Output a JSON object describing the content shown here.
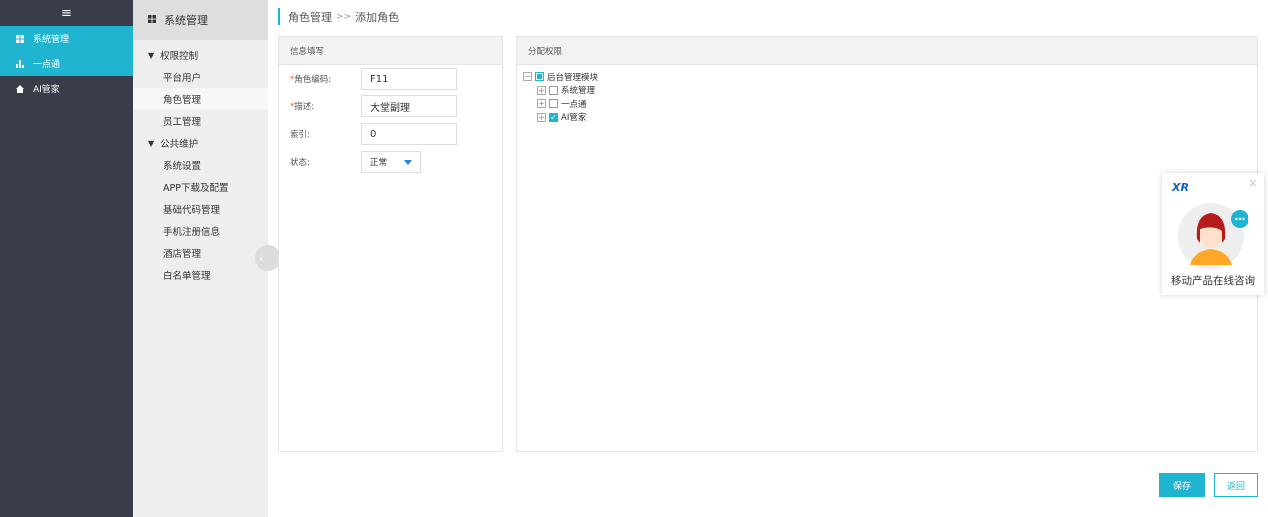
{
  "sidebar": {
    "menu_icon": "≡",
    "items": [
      {
        "label": "系统管理",
        "icon": "grid-icon"
      },
      {
        "label": "一点通",
        "icon": "bar-chart-icon"
      },
      {
        "label": "AI管家",
        "icon": "house-icon"
      }
    ]
  },
  "submenu": {
    "header": "系统管理",
    "groups": [
      {
        "label": "权限控制",
        "items": [
          "平台用户",
          "角色管理",
          "员工管理"
        ]
      },
      {
        "label": "公共维护",
        "items": [
          "系统设置",
          "APP下载及配置",
          "基础代码管理",
          "手机注册信息",
          "酒店管理",
          "白名单管理"
        ]
      }
    ]
  },
  "breadcrumb": {
    "parent": "角色管理",
    "sep": ">>",
    "current": "添加角色"
  },
  "form_panel": {
    "title": "信息填写",
    "fields": {
      "code": {
        "label": "角色编码:",
        "value": "F11"
      },
      "desc": {
        "label": "描述:",
        "value": "大堂副理"
      },
      "index": {
        "label": "索引:",
        "value": "0"
      },
      "status": {
        "label": "状态:",
        "value": "正常"
      }
    },
    "required_mark": "*"
  },
  "perm_panel": {
    "title": "分配权限",
    "root": "后台管理模块",
    "children": [
      {
        "label": "系统管理",
        "checked": false
      },
      {
        "label": "一点通",
        "checked": false
      },
      {
        "label": "AI管家",
        "checked": true
      }
    ]
  },
  "buttons": {
    "save": "保存",
    "back": "返回"
  },
  "consult": {
    "logo": "XR",
    "text": "移动产品在线咨询"
  },
  "colors": {
    "accent": "#1fb5d1",
    "sidebar": "#393d49",
    "required": "#ff5722"
  }
}
